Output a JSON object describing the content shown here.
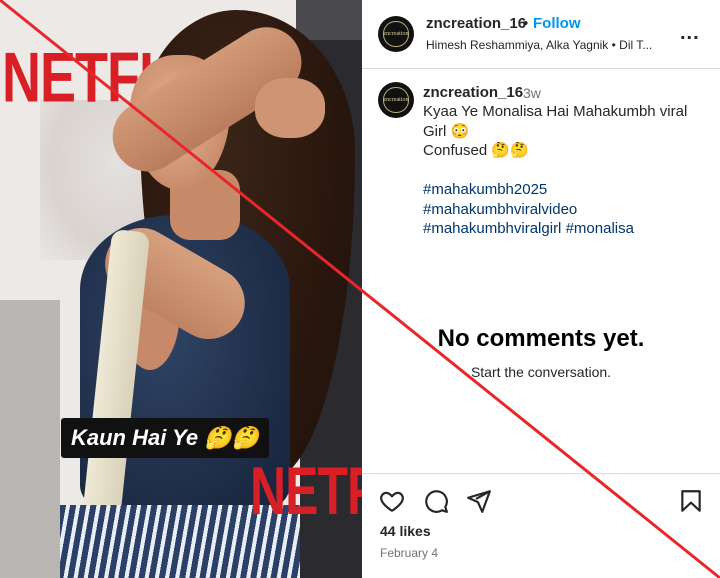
{
  "media": {
    "brand_top": "NETFLIX",
    "brand_bottom": "NETFLIX",
    "caption_text": "Kaun Hai Ye 🤔🤔"
  },
  "header": {
    "avatar_text": "zncreation",
    "username": "zncreation_16",
    "separator": "•",
    "follow_label": "Follow",
    "audio": "Himesh Reshammiya, Alka Yagnik • Dil T...",
    "more_label": "..."
  },
  "caption": {
    "username": "zncreation_16",
    "time": "3w",
    "lines": [
      "Kyaa Ye Monalisa Hai Mahakumbh viral Girl 😳",
      "Confused 🤔🤔"
    ],
    "hashtags": [
      "#mahakumbh2025",
      "#mahakumbhviralvideo",
      "#mahakumbhviralgirl",
      "#monalisa"
    ]
  },
  "comments": {
    "empty_title": "No comments yet.",
    "empty_subtitle": "Start the conversation."
  },
  "actions": {
    "icons": [
      "heart-icon",
      "comment-icon",
      "share-icon",
      "bookmark-icon"
    ]
  },
  "stats": {
    "likes": "44 likes",
    "date": "February 4"
  },
  "colors": {
    "follow": "#0095f6",
    "hashtag": "#00376b",
    "cross_line": "#e8262b",
    "brand_red": "#d81f26"
  }
}
